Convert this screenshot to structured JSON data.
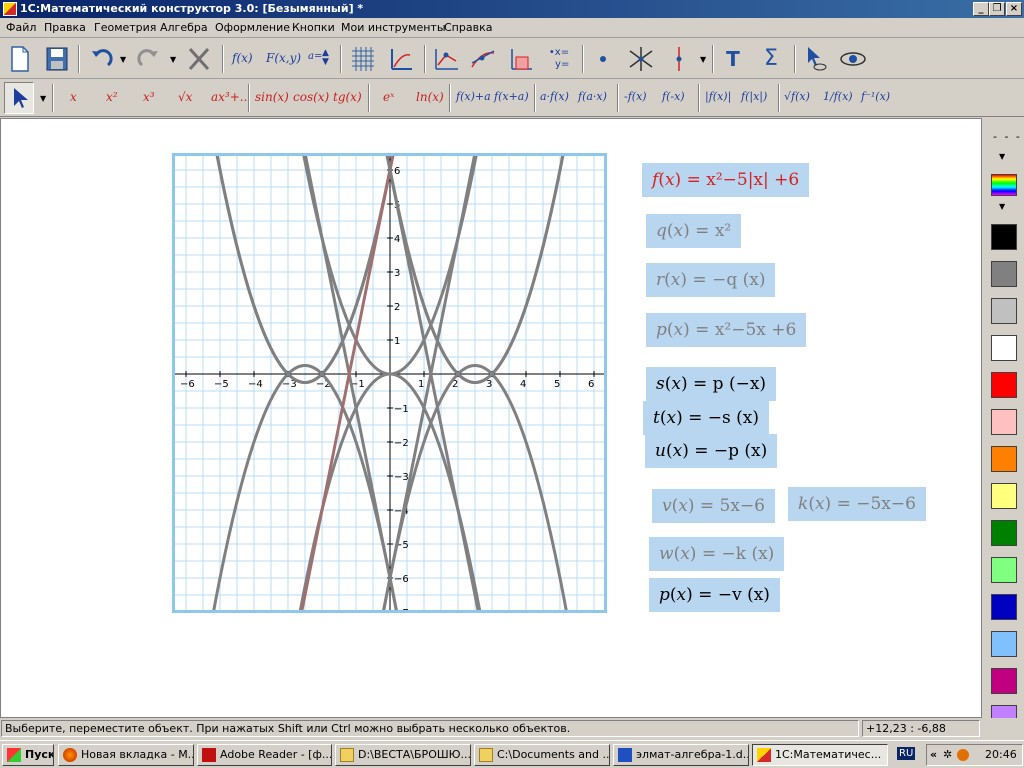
{
  "window": {
    "title": "1С:Математический конструктор 3.0: [Безымянный] *"
  },
  "menu": [
    "Файл",
    "Правка",
    "Геометрия",
    "Алгебра",
    "Оформление",
    "Кнопки",
    "Мои инструменты",
    "Справка"
  ],
  "toolbar1": {
    "fx": "f(x)",
    "fxy": "F(x,y)",
    "param": "a="
  },
  "toolbar2": [
    "x",
    "x²",
    "x³",
    "√x",
    "ax³+..",
    "sin(x)",
    "cos(x)",
    "tg(x)",
    "eˣ",
    "ln(x)",
    "f(x)+a",
    "f(x+a)",
    "a·f(x)",
    "f(a·x)",
    "-f(x)",
    "f(-x)",
    "|f(x)|",
    "f(|x|)",
    "√f(x)",
    "1/f(x)",
    "f⁻¹(x)"
  ],
  "graph": {
    "x_ticks": [
      "−6",
      "−5",
      "−4",
      "−3",
      "−2",
      "−1",
      "1",
      "2",
      "3",
      "4",
      "5",
      "6"
    ],
    "y_ticks": [
      "6",
      "5",
      "4",
      "3",
      "2",
      "1",
      "−1",
      "−2",
      "−3",
      "−4",
      "−5",
      "−6",
      "−7"
    ]
  },
  "formulas": {
    "f": {
      "name": "f",
      "arg": "x",
      "rhs": "= x²−5|x| +6"
    },
    "q": {
      "name": "q",
      "arg": "x",
      "rhs": "= x²"
    },
    "r": {
      "name": "r",
      "arg": "x",
      "rhs": "= −q (x)"
    },
    "p1": {
      "name": "p",
      "arg": "x",
      "rhs": "= x²−5x +6"
    },
    "s": {
      "name": "s",
      "arg": "x",
      "rhs": "= p (−x)"
    },
    "t": {
      "name": "t",
      "arg": "x",
      "rhs": "= −s (x)"
    },
    "u": {
      "name": "u",
      "arg": "x",
      "rhs": "= −p (x)"
    },
    "v": {
      "name": "v",
      "arg": "x",
      "rhs": "= 5x−6"
    },
    "k": {
      "name": "k",
      "arg": "x",
      "rhs": "= −5x−6"
    },
    "w": {
      "name": "w",
      "arg": "x",
      "rhs": "= −k (x)"
    },
    "p2": {
      "name": "p",
      "arg": "x",
      "rhs": "= −v (x)"
    }
  },
  "palette": {
    "colors": [
      "#000000",
      "#808080",
      "#c0c0c0",
      "#ffffff",
      "#ff0000",
      "#ffc0c0",
      "#ff8000",
      "#ffff80",
      "#008000",
      "#80ff80",
      "#0000c0",
      "#80c0ff",
      "#c00080",
      "#c080ff"
    ]
  },
  "status": {
    "message": "Выберите, переместите объект. При нажатых Shift или Ctrl можно выбрать несколько объектов.",
    "coords": "+12,23 : -6,88"
  },
  "taskbar": {
    "start": "Пуск",
    "items": [
      "Новая вкладка - M...",
      "Adobe Reader - [ф...",
      "D:\\ВЕСТА\\БРОШЮ...",
      "C:\\Documents and ...",
      "элмат-алгебра-1.d...",
      "1С:Математичес..."
    ],
    "lang": "RU",
    "clock": "20:46"
  }
}
